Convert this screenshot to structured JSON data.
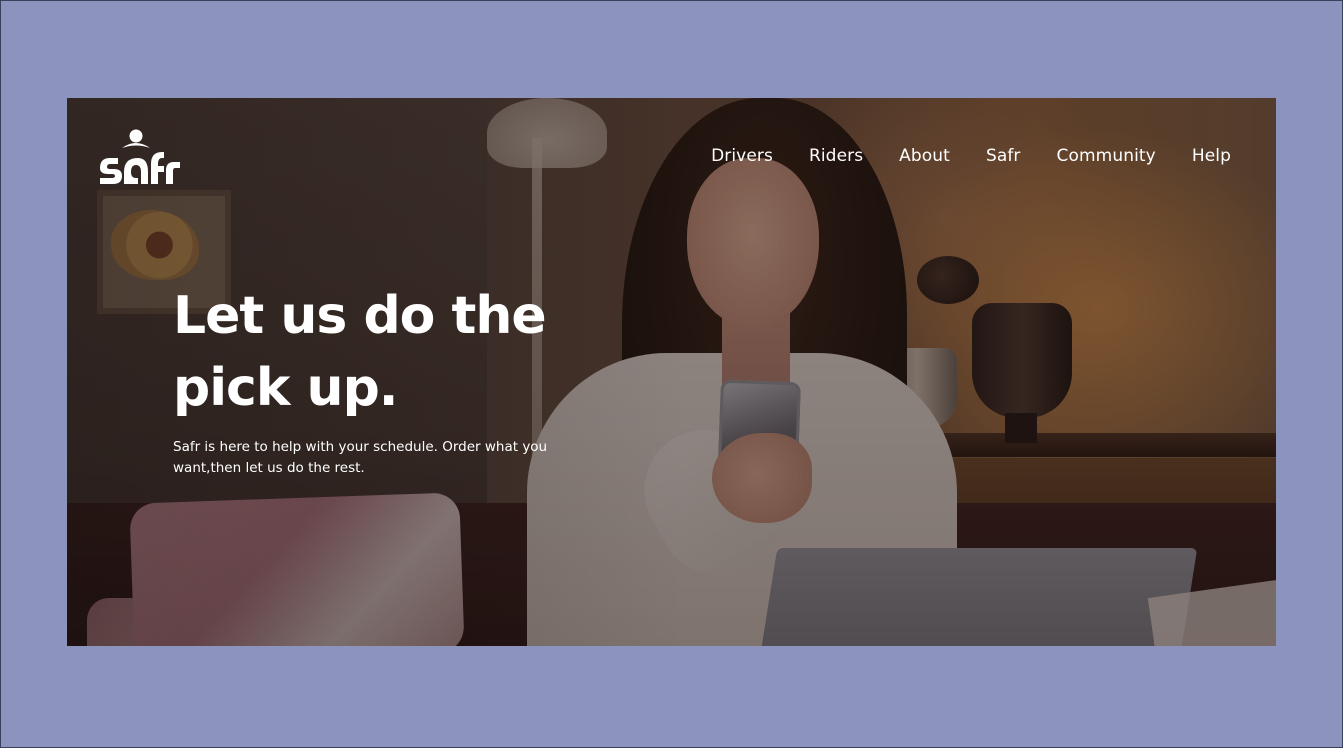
{
  "brand": {
    "logo_text": "safr"
  },
  "nav": {
    "items": [
      {
        "label": "Drivers"
      },
      {
        "label": "Riders"
      },
      {
        "label": "About"
      },
      {
        "label": "Safr"
      },
      {
        "label": "Community"
      },
      {
        "label": "Help"
      }
    ]
  },
  "hero": {
    "headline": "Let us do the pick up.",
    "subtext": "Safr is here to help with your schedule. Order what you want,then let us do the rest."
  },
  "colors": {
    "outer_background": "#8c93bc",
    "text": "#ffffff"
  }
}
